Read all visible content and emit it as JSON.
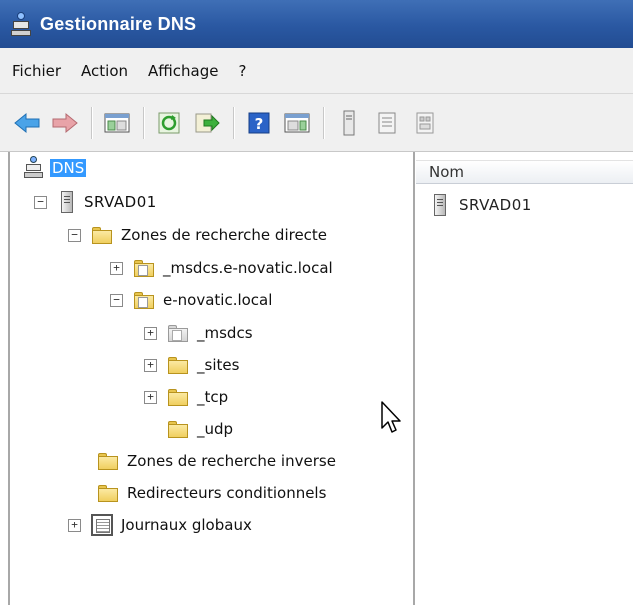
{
  "window": {
    "title": "Gestionnaire DNS"
  },
  "menu": {
    "items": [
      "Fichier",
      "Action",
      "Affichage",
      "?"
    ]
  },
  "toolbar": {
    "buttons": [
      "back-icon",
      "forward-icon",
      "|",
      "show-hide-console-tree-icon",
      "|",
      "refresh-icon",
      "export-list-icon",
      "|",
      "help-icon",
      "show-hide-action-pane-icon",
      "|",
      "server-icon",
      "list-view-icon",
      "properties-icon"
    ]
  },
  "tree": {
    "root": "DNS",
    "server": "SRVAD01",
    "forward_zones": "Zones de recherche directe",
    "zone_msdcs": "_msdcs.e-novatic.local",
    "zone_local": "e-novatic.local",
    "sub_msdcs": "_msdcs",
    "sub_sites": "_sites",
    "sub_tcp": "_tcp",
    "sub_udp": "_udp",
    "reverse_zones": "Zones de recherche inverse",
    "conditional_forwarders": "Redirecteurs conditionnels",
    "global_logs": "Journaux globaux"
  },
  "list": {
    "column_name": "Nom",
    "rows": [
      "SRVAD01"
    ]
  }
}
